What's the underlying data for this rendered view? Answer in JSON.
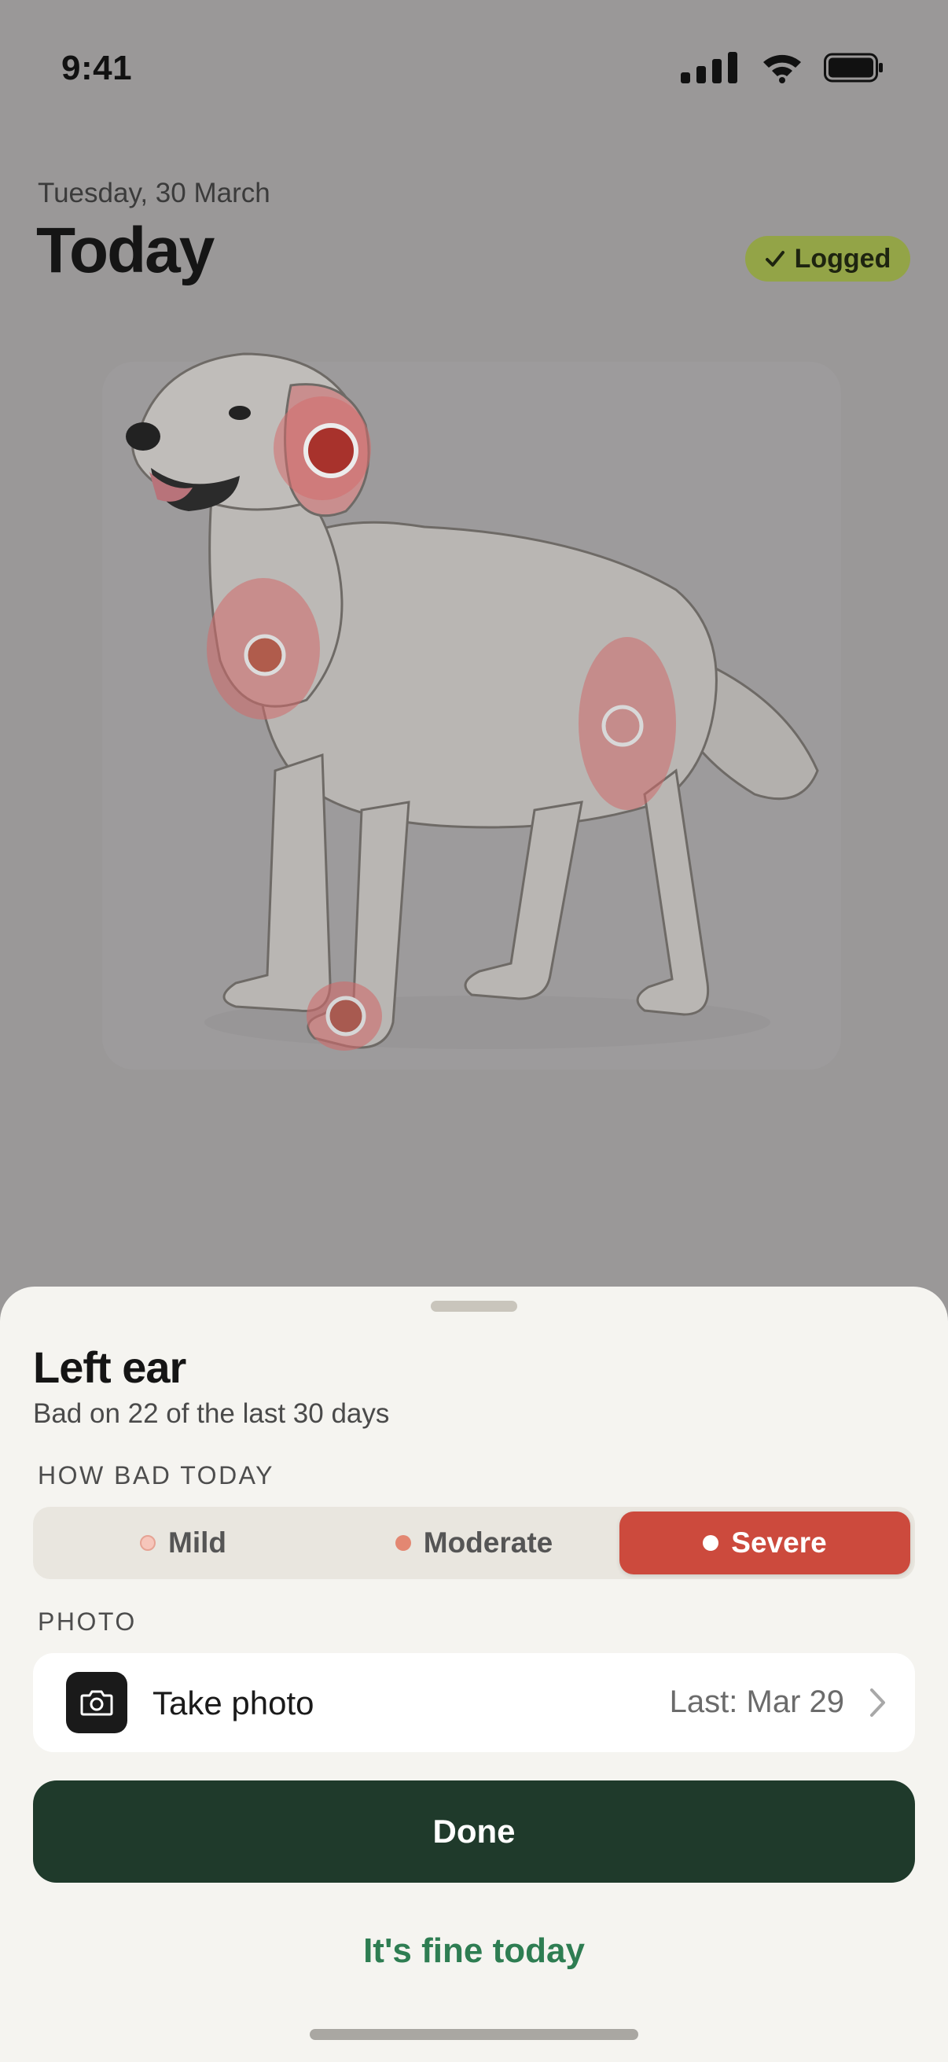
{
  "status_bar": {
    "time": "9:41",
    "icons": [
      "cellular-signal-icon",
      "wifi-icon",
      "battery-icon"
    ]
  },
  "header": {
    "date": "Tuesday, 30 March",
    "title": "Today",
    "badge": {
      "label": "Logged",
      "icon": "checkmark-icon",
      "color": "#93a447"
    }
  },
  "body_map": {
    "image": "dog-illustration",
    "spots": [
      {
        "name": "left-ear",
        "severity": "severe",
        "selected": true
      },
      {
        "name": "chest",
        "severity": "moderate",
        "selected": false
      },
      {
        "name": "hip",
        "severity": "moderate",
        "selected": false
      },
      {
        "name": "front-paw",
        "severity": "moderate",
        "selected": false
      }
    ]
  },
  "sheet": {
    "title": "Left ear",
    "subtitle": "Bad on 22 of the last 30 days",
    "severity_label": "HOW BAD TODAY",
    "severity_options": [
      {
        "label": "Mild",
        "dot_color": "#f6c6bb"
      },
      {
        "label": "Moderate",
        "dot_color": "#e38772"
      },
      {
        "label": "Severe",
        "dot_color": "#ffffff"
      }
    ],
    "severity_selected": "Severe",
    "photo_label": "PHOTO",
    "photo": {
      "action": "Take photo",
      "last": "Last: Mar 29",
      "icon": "camera-icon"
    },
    "done_label": "Done",
    "fine_label": "It's fine today"
  },
  "colors": {
    "accent_dark_green": "#1f3a2b",
    "link_green": "#2e7d52",
    "severe_red": "#cc4a3d",
    "sheet_bg": "#f5f4f0"
  }
}
